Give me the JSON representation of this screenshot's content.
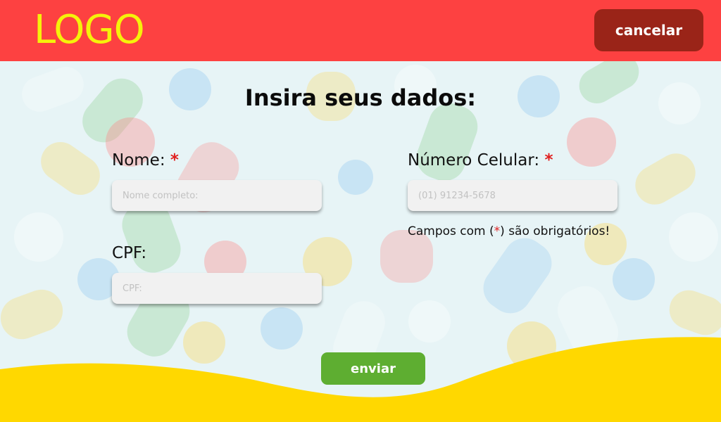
{
  "header": {
    "logo_text": "LOGO",
    "cancel_label": "cancelar"
  },
  "form": {
    "title": "Insira seus dados:",
    "name": {
      "label": "Nome:",
      "required_mark": "*",
      "placeholder": "Nome completo:",
      "value": ""
    },
    "phone": {
      "label": "Número Celular:",
      "required_mark": "*",
      "placeholder": "(01) 91234-5678",
      "value": ""
    },
    "cpf": {
      "label": "CPF:",
      "placeholder": "CPF:",
      "value": ""
    },
    "required_note": {
      "before": "Campos com (",
      "mark": "*",
      "after": ") são obrigatórios!"
    },
    "submit_label": "enviar"
  },
  "colors": {
    "header_bg": "#fd4141",
    "logo": "#f5f20a",
    "cancel_bg": "#9a2418",
    "submit_bg": "#5eae31",
    "wave": "#ffd800",
    "required": "#e02020",
    "page_bg": "#e7f4f6"
  }
}
